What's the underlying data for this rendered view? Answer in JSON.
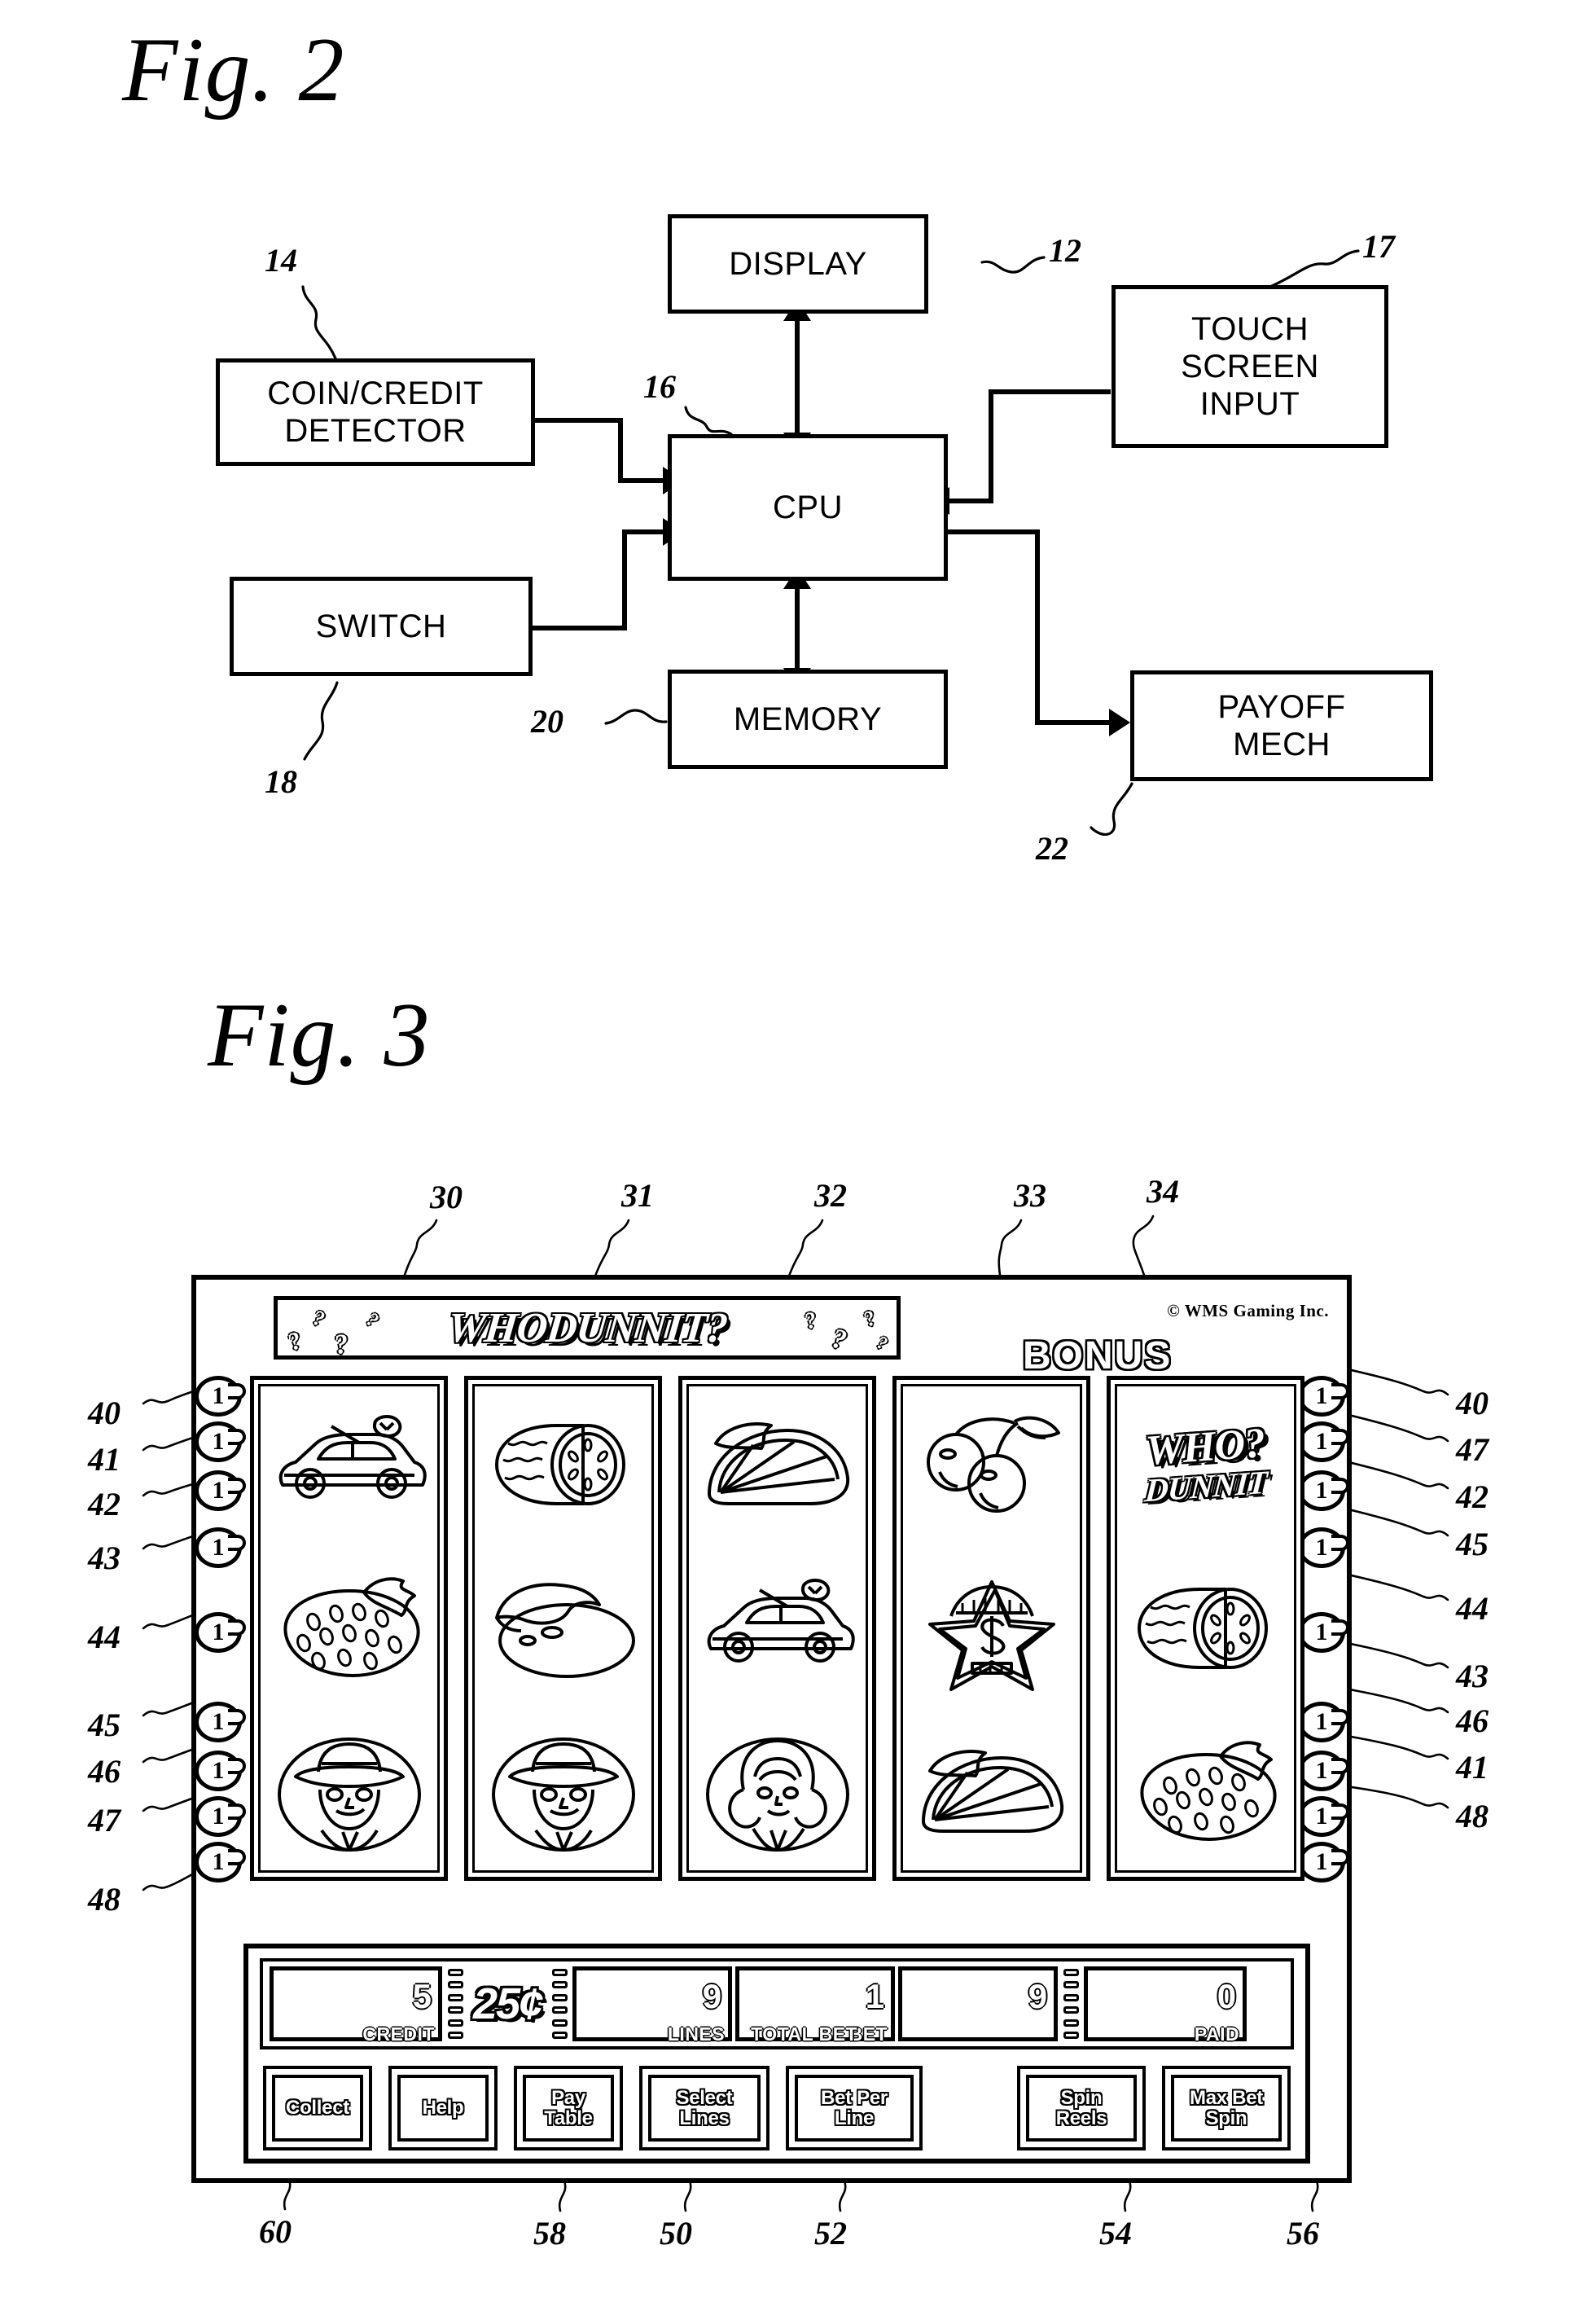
{
  "figures": {
    "fig2": {
      "caption": "Fig. 2",
      "blocks": [
        {
          "id": "display",
          "label": "DISPLAY",
          "ref": "12"
        },
        {
          "id": "coin_credit",
          "label": "COIN/CREDIT\nDETECTOR",
          "ref": "14"
        },
        {
          "id": "cpu",
          "label": "CPU",
          "ref": "16"
        },
        {
          "id": "touch_screen",
          "label": "TOUCH\nSCREEN\nINPUT",
          "ref": "17"
        },
        {
          "id": "switch",
          "label": "SWITCH",
          "ref": "18"
        },
        {
          "id": "memory",
          "label": "MEMORY",
          "ref": "20"
        },
        {
          "id": "payoff",
          "label": "PAYOFF\nMECH",
          "ref": "22"
        }
      ],
      "block_labels": {
        "display": "DISPLAY",
        "coin_credit_line1": "COIN/CREDIT",
        "coin_credit_line2": "DETECTOR",
        "cpu": "CPU",
        "touch_line1": "TOUCH",
        "touch_line2": "SCREEN",
        "touch_line3": "INPUT",
        "switch": "SWITCH",
        "memory": "MEMORY",
        "payoff_line1": "PAYOFF",
        "payoff_line2": "MECH"
      },
      "refs": {
        "display": "12",
        "coin_credit": "14",
        "cpu": "16",
        "touch_screen": "17",
        "switch": "18",
        "memory": "20",
        "payoff": "22"
      }
    },
    "fig3": {
      "caption": "Fig. 3",
      "top_refs": [
        "30",
        "31",
        "32",
        "33",
        "34"
      ],
      "left_refs": [
        "40",
        "41",
        "42",
        "43",
        "44",
        "45",
        "46",
        "47",
        "48"
      ],
      "right_refs": [
        "40",
        "47",
        "42",
        "45",
        "44",
        "43",
        "46",
        "41",
        "48"
      ],
      "bottom_refs": [
        "60",
        "58",
        "50",
        "52",
        "54",
        "56"
      ],
      "banner": {
        "title": "WHODUNNIT?",
        "copyright": "© WMS Gaming Inc.",
        "bonus": "BONUS"
      },
      "coin_button_value": "1",
      "reels": [
        {
          "index": 1,
          "symbols": [
            "car",
            "strawberry",
            "detective-man"
          ]
        },
        {
          "index": 2,
          "symbols": [
            "melon",
            "banana-melon",
            "detective-man"
          ]
        },
        {
          "index": 3,
          "symbols": [
            "orange-slice",
            "car",
            "woman"
          ]
        },
        {
          "index": 4,
          "symbols": [
            "cherries",
            "dollar-star",
            "orange-slice"
          ]
        },
        {
          "index": 5,
          "symbols": [
            "whodunnit-logo",
            "melon",
            "strawberry"
          ]
        }
      ],
      "reel_logo": {
        "line1": "WHO?",
        "line2": "DUNNIT"
      },
      "meters": [
        {
          "id": "credit",
          "label": "CREDIT",
          "value": "5"
        },
        {
          "id": "lines",
          "label": "LINES",
          "value": "9"
        },
        {
          "id": "bet",
          "label": "BET",
          "value": "1"
        },
        {
          "id": "total_bet",
          "label": "TOTAL BET",
          "value": "9"
        },
        {
          "id": "paid",
          "label": "PAID",
          "value": "0"
        }
      ],
      "denomination": "25¢",
      "buttons": [
        {
          "id": "collect",
          "label": "Collect",
          "ref": "60"
        },
        {
          "id": "help",
          "label": "Help",
          "ref": ""
        },
        {
          "id": "pay_table",
          "label": "Pay\nTable",
          "ref": "58"
        },
        {
          "id": "select_lines",
          "label": "Select\nLines",
          "ref": "50"
        },
        {
          "id": "bet_per_line",
          "label": "Bet Per\nLine",
          "ref": "52"
        },
        {
          "id": "spin_reels",
          "label": "Spin\nReels",
          "ref": "54"
        },
        {
          "id": "max_bet_spin",
          "label": "Max Bet\nSpin",
          "ref": "56"
        }
      ]
    }
  }
}
